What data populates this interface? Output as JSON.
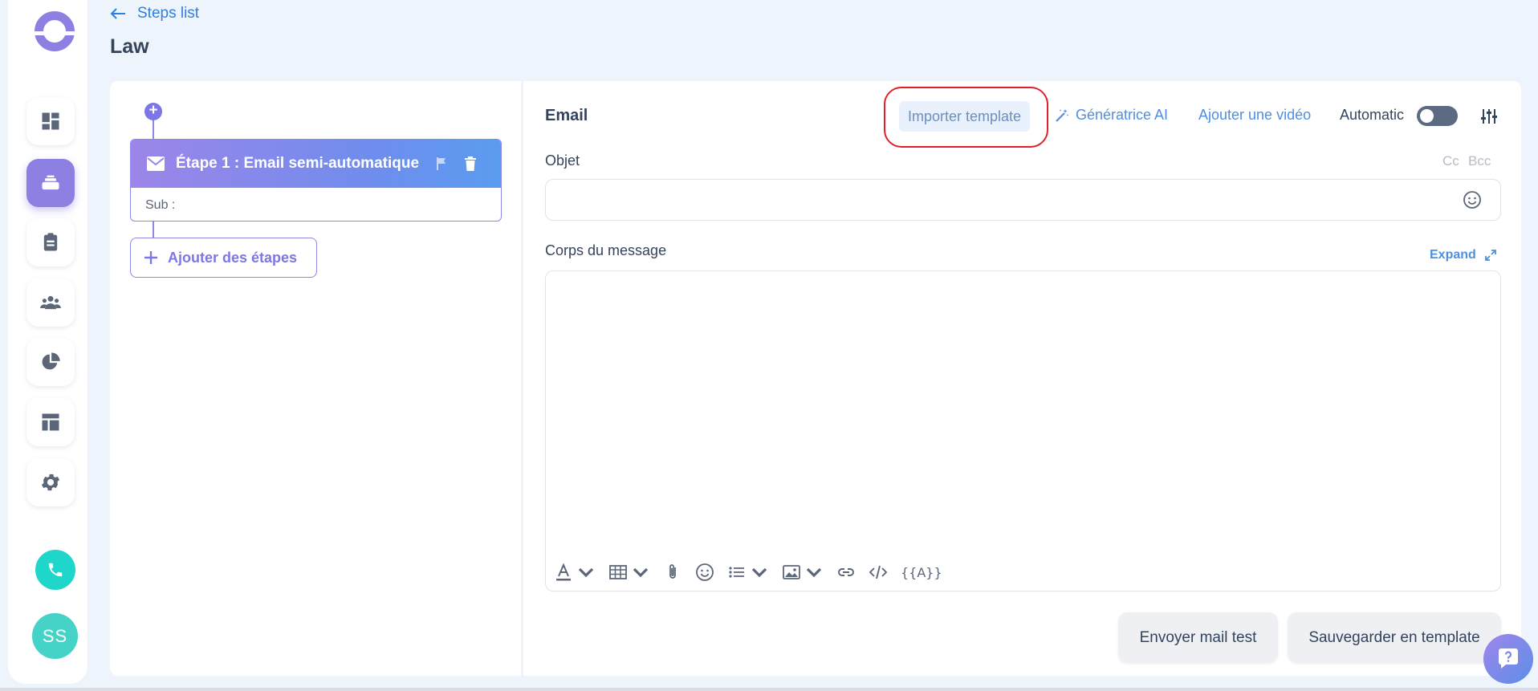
{
  "header": {
    "back_label": "Steps list",
    "title": "Law"
  },
  "sidebar": {
    "items": [
      {
        "icon": "dashboard-icon",
        "active": false
      },
      {
        "icon": "campaigns-icon",
        "active": true
      },
      {
        "icon": "tasks-icon",
        "active": false
      },
      {
        "icon": "contacts-icon",
        "active": false
      },
      {
        "icon": "reports-icon",
        "active": false
      },
      {
        "icon": "templates-icon",
        "active": false
      },
      {
        "icon": "settings-icon",
        "active": false
      }
    ],
    "avatar_initials": "SS",
    "accent": "#8c80e2",
    "call_color": "#1ed6c9"
  },
  "steps": {
    "step1_title": "Étape 1 : Email semi-automatique",
    "step1_sub": "Sub :",
    "add_steps_label": "Ajouter des étapes"
  },
  "editor": {
    "channel_label": "Email",
    "import_template": "Importer template",
    "ai_generator": "Génératrice AI",
    "add_video": "Ajouter une vidéo",
    "automatic_label": "Automatic",
    "automatic_on": false,
    "subject_label": "Objet",
    "cc": "Cc",
    "bcc": "Bcc",
    "subject_value": "",
    "body_label": "Corps du message",
    "expand_label": "Expand",
    "body_value": "",
    "variables_label": "{{A}}",
    "send_test_label": "Envoyer mail test",
    "save_template_label": "Sauvegarder en template"
  }
}
